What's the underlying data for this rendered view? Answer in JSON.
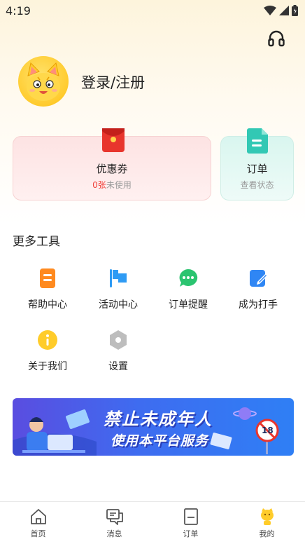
{
  "status_bar": {
    "time": "4:19"
  },
  "header": {
    "support_icon": "headset-icon"
  },
  "profile": {
    "login_label": "登录/注册",
    "avatar_icon": "cat-avatar"
  },
  "cards": {
    "coupon": {
      "title": "优惠券",
      "count": "0张",
      "subtitle_rest": "未使用",
      "icon": "red-envelope-icon"
    },
    "order": {
      "title": "订单",
      "subtitle": "查看状态",
      "icon": "document-icon"
    }
  },
  "tools": {
    "section_title": "更多工具",
    "items": [
      {
        "label": "帮助中心",
        "icon": "help-icon",
        "color": "#ff8a1f"
      },
      {
        "label": "活动中心",
        "icon": "flag-icon",
        "color": "#2f9bf4"
      },
      {
        "label": "订单提醒",
        "icon": "chat-icon",
        "color": "#2bc470"
      },
      {
        "label": "成为打手",
        "icon": "edit-icon",
        "color": "#2f86f4"
      },
      {
        "label": "关于我们",
        "icon": "info-icon",
        "color": "#ffcc2a"
      },
      {
        "label": "设置",
        "icon": "settings-icon",
        "color": "#bdbdbd"
      }
    ]
  },
  "banner": {
    "line1": "禁止未成年人",
    "line2": "使用本平台服务",
    "badge": "18"
  },
  "tabbar": {
    "items": [
      {
        "label": "首页",
        "icon": "home-icon"
      },
      {
        "label": "消息",
        "icon": "message-icon"
      },
      {
        "label": "订单",
        "icon": "order-icon"
      },
      {
        "label": "我的",
        "icon": "profile-icon",
        "active": true
      }
    ]
  }
}
